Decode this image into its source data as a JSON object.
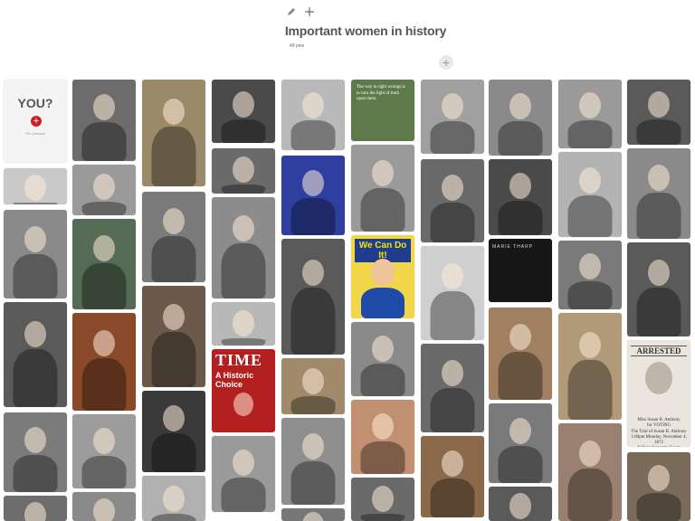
{
  "board": {
    "title": "Important women in history",
    "pin_count": "49 pins",
    "add_label": "+"
  },
  "toolbar": {
    "edit_icon": "pencil-icon",
    "move_icon": "move-icon"
  },
  "create_card": {
    "heading": "YOU?",
    "plus": "+",
    "caption": "Pin yourself"
  },
  "pins": {
    "quote_text": "The way to right wrongs is to turn the light of truth upon them.",
    "rosie": "We Can Do It!",
    "time_logo": "TIME",
    "time_sub": "A Historic Choice",
    "marie": "MARIE THARP",
    "poster_head": "ARRESTED",
    "poster_body": "Miss Susan B. Anthony\nfor VOTING\nThe Trial of Susan B. Anthony\n1:00pm Monday, November 4, 1872\nIndiana Supreme Court\nFREE & OPEN TO THE PUBLIC"
  },
  "colors": {
    "accent": "#cb2027",
    "title": "#555555"
  }
}
